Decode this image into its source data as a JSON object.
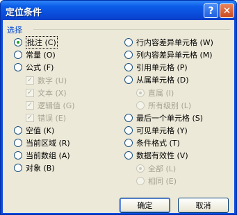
{
  "window": {
    "title": "定位条件",
    "help_button": "?",
    "close_button": "✕"
  },
  "group": {
    "label": "选择"
  },
  "left_options": [
    {
      "label": "批注 (C)",
      "type": "radio",
      "checked": true,
      "disabled": false
    },
    {
      "label": "常量 (O)",
      "type": "radio",
      "checked": false,
      "disabled": false
    },
    {
      "label": "公式 (F)",
      "type": "radio",
      "checked": false,
      "disabled": false
    },
    {
      "label": "数字 (U)",
      "type": "check",
      "checked": true,
      "disabled": true
    },
    {
      "label": "文本 (X)",
      "type": "check",
      "checked": true,
      "disabled": true
    },
    {
      "label": "逻辑值 (G)",
      "type": "check",
      "checked": true,
      "disabled": true
    },
    {
      "label": "错误 (E)",
      "type": "check",
      "checked": true,
      "disabled": true
    },
    {
      "label": "空值 (K)",
      "type": "radio",
      "checked": false,
      "disabled": false
    },
    {
      "label": "当前区域 (R)",
      "type": "radio",
      "checked": false,
      "disabled": false
    },
    {
      "label": "当前数组 (A)",
      "type": "radio",
      "checked": false,
      "disabled": false
    },
    {
      "label": "对象 (B)",
      "type": "radio",
      "checked": false,
      "disabled": false
    }
  ],
  "right_options": [
    {
      "label": "行内容差异单元格 (W)",
      "type": "radio",
      "checked": false,
      "disabled": false
    },
    {
      "label": "列内容差异单元格 (M)",
      "type": "radio",
      "checked": false,
      "disabled": false
    },
    {
      "label": "引用单元格 (P)",
      "type": "radio",
      "checked": false,
      "disabled": false
    },
    {
      "label": "从属单元格 (D)",
      "type": "radio",
      "checked": false,
      "disabled": false
    },
    {
      "label": "直属 (I)",
      "type": "radio",
      "checked": true,
      "disabled": true
    },
    {
      "label": "所有级别 (L)",
      "type": "radio",
      "checked": false,
      "disabled": true
    },
    {
      "label": "最后一个单元格 (S)",
      "type": "radio",
      "checked": false,
      "disabled": false
    },
    {
      "label": "可见单元格 (Y)",
      "type": "radio",
      "checked": false,
      "disabled": false
    },
    {
      "label": "条件格式 (T)",
      "type": "radio",
      "checked": false,
      "disabled": false
    },
    {
      "label": "数据有效性 (V)",
      "type": "radio",
      "checked": false,
      "disabled": false
    },
    {
      "label": "全部 (L)",
      "type": "radio",
      "checked": true,
      "disabled": true
    },
    {
      "label": "相同 (E)",
      "type": "radio",
      "checked": false,
      "disabled": true
    }
  ],
  "buttons": {
    "ok": "确定",
    "cancel": "取消"
  }
}
